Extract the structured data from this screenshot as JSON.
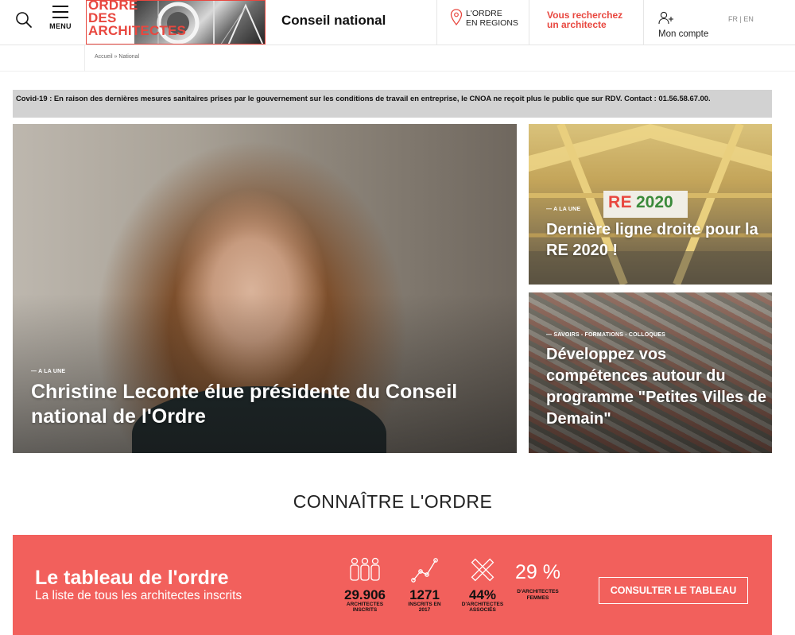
{
  "header": {
    "menu_label": "MENU",
    "logo_lines": [
      "ORDRE",
      "DES",
      "ARCHITECTES"
    ],
    "site_title": "Conseil national",
    "regions_line1": "L'ORDRE",
    "regions_line2": "EN REGIONS",
    "search_architect_line1": "Vous recherchez",
    "search_architect_line2": "un architecte",
    "account_label": "Mon compte",
    "lang_fr": "FR",
    "lang_sep": "|",
    "lang_en": "EN"
  },
  "breadcrumb": {
    "home": "Accueil",
    "sep": "»",
    "current": "National"
  },
  "covid_banner": "Covid-19 : En raison des dernières mesures sanitaires prises par le gouvernement sur les conditions de travail en entreprise, le CNOA ne reçoit plus le public que sur RDV. Contact : 01.56.58.67.00.",
  "cards": {
    "main": {
      "kicker": "— A LA UNE",
      "title": "Christine Leconte élue présidente du Conseil national de l'Ordre"
    },
    "re2020": {
      "badge_re": "RE",
      "badge_year": "2020",
      "kicker": "— A LA UNE",
      "title": "Dernière ligne droite pour la RE 2020 !"
    },
    "pvd": {
      "kicker": "— SAVOIRS - FORMATIONS - COLLOQUES",
      "title": "Développez vos compétences autour du programme \"Petites Villes de Demain\""
    }
  },
  "section_title": "CONNAÎTRE L'ORDRE",
  "tableau": {
    "heading": "Le tableau de l'ordre",
    "subheading": "La liste de tous les architectes inscrits",
    "stats": [
      {
        "value": "29.906",
        "caption_1": "ARCHITECTES",
        "caption_2": "INSCRITS",
        "icon": "people-icon"
      },
      {
        "value": "1271",
        "caption_1": "INSCRITS EN",
        "caption_2": "2017",
        "icon": "trend-line-icon"
      },
      {
        "value": "44%",
        "caption_1": "D'ARCHITECTES",
        "caption_2": "ASSOCIÉS",
        "icon": "tools-icon"
      }
    ],
    "women_pct": "29 %",
    "women_caption_1": "D'ARCHITECTES",
    "women_caption_2": "FEMMES",
    "cta_label": "CONSULTER LE TABLEAU"
  },
  "colors": {
    "brand_red": "#e8473f",
    "band_red": "#f2605c",
    "covid_bg": "#d2d2d2"
  }
}
